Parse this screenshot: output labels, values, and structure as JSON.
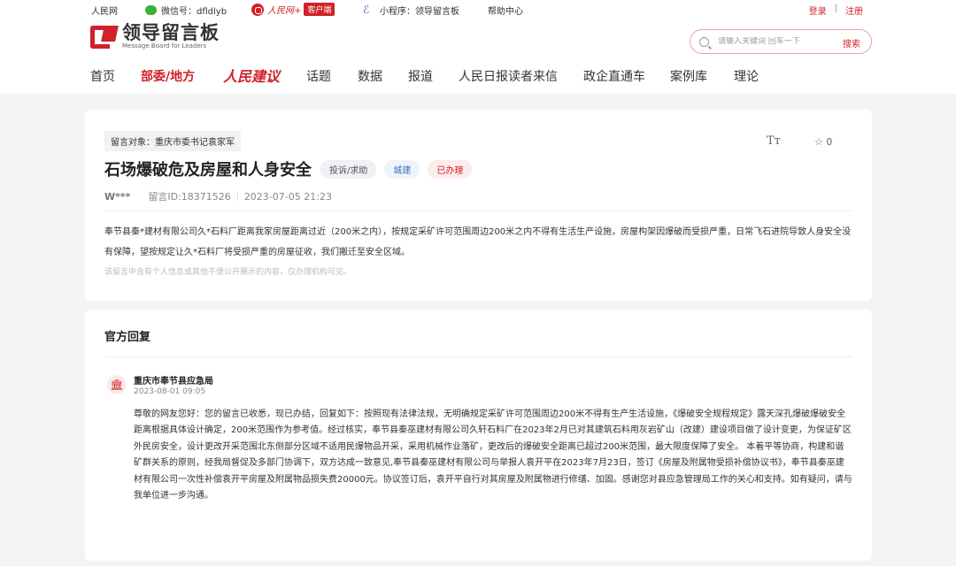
{
  "topbar": {
    "site": "人民网",
    "wechat": "微信号：dfldlyb",
    "app_name": "人民网+",
    "app_client": "客户端",
    "miniprogram": "小程序：领导留言板",
    "help": "帮助中心",
    "login": "登录",
    "separator": "|",
    "register": "注册"
  },
  "logo": {
    "cn": "领导留言板",
    "en": "Message Board for Leaders"
  },
  "search": {
    "placeholder": "请输入关键词 回车一下",
    "button": "搜索"
  },
  "nav": {
    "items": [
      {
        "label": "首页"
      },
      {
        "label": "部委/地方"
      },
      {
        "label": "人民建议"
      },
      {
        "label": "话题"
      },
      {
        "label": "数据"
      },
      {
        "label": "报道"
      },
      {
        "label": "人民日报读者来信"
      },
      {
        "label": "政企直通车"
      },
      {
        "label": "案例库"
      },
      {
        "label": "理论"
      }
    ],
    "active_index": 1
  },
  "message": {
    "target": "留言对象：重庆市委书记袁家军",
    "font_icon": "Tт",
    "fav_icon": "☆",
    "fav_count": "0",
    "title": "石场爆破危及房屋和人身安全",
    "tags": [
      "投诉/求助",
      "城建",
      "已办理"
    ],
    "user": "W***",
    "id": "留言ID:18371526",
    "time": "2023-07-05 21:23",
    "content": "奉节县秦*建材有限公司久*石料厂距离我家房屋距离过近（200米之内），按规定采矿许可范围周边200米之内不得有生活生产设施，房屋构架因爆破而受损严重，日常飞石进院导致人身安全没有保障，望按规定让久*石料厂将受损严重的房屋征收，我们搬迁至安全区域。",
    "notice": "该留言中含有个人信息或其他不便公开展示的内容，仅办理机构可见。"
  },
  "reply": {
    "section_title": "官方回复",
    "org_icon": "🏛",
    "org": "重庆市奉节县应急局",
    "time": "2023-08-01 09:05",
    "body": "尊敬的网友您好：您的留言已收悉，现已办结，回复如下：按照现有法律法规，无明确规定采矿许可范围周边200米不得有生产生活设施，《爆破安全规程规定》露天深孔爆破爆破安全距离根据具体设计确定，200米范围作为参考值。经过核实，奉节县秦巫建材有限公司久轩石料厂在2023年2月已对其建筑石料用灰岩矿山（改建）建设项目做了设计变更，为保证矿区外民房安全，设计更改开采范围北东侧部分区域不适用民爆物品开采，采用机械作业落矿，更改后的爆破安全距离已超过200米范围，最大限度保障了安全。 本着平等协商，构建和谐矿群关系的原则，经我局督促及多部门协调下，双方达成一致意见,奉节县秦巫建材有限公司与举报人袁开平在2023年7月23日，签订《房屋及附属物受损补偿协议书》，奉节县秦巫建材有限公司一次性补偿袁开平房屋及附属物品损失费20000元。协议签订后，袁开平自行对其房屋及附属物进行修缮、加固。感谢您对县应急管理局工作的关心和支持。如有疑问，请与我单位进一步沟通。"
  },
  "colors": {
    "brand": "#d0222a",
    "background": "#f4f4f4",
    "blue_tag": "#3a74c2"
  }
}
